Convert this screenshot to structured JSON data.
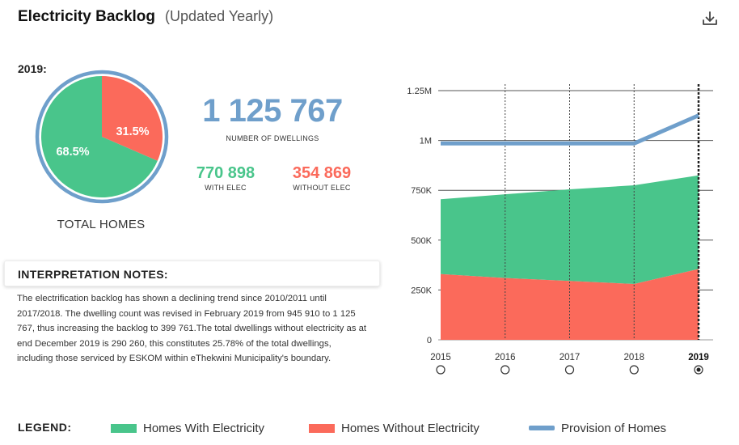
{
  "header": {
    "title": "Electricity Backlog",
    "subtitle": "(Updated Yearly)",
    "download_icon": "download-icon"
  },
  "year_label": "2019:",
  "pie": {
    "slices": [
      {
        "label": "68.5%",
        "value": 68.5,
        "color": "#49c58b"
      },
      {
        "label": "31.5%",
        "value": 31.5,
        "color": "#fb6a5b"
      }
    ],
    "ring_color": "#6f9fcb",
    "caption": "TOTAL HOMES"
  },
  "stats": {
    "dwellings_value": "1 125 767",
    "dwellings_caption": "NUMBER OF DWELLINGS",
    "with_elec_value": "770 898",
    "with_elec_caption": "WITH ELEC",
    "without_elec_value": "354 869",
    "without_elec_caption": "WITHOUT ELEC"
  },
  "notes": {
    "title": "INTERPRETATION NOTES:",
    "text": "The electrification backlog has shown a declining trend since 2010/2011 until 2017/2018. The dwelling count was revised in February 2019 from 945 910 to 1 125 767, thus increasing the backlog to 399 761.The total dwellings without electricity as at end December 2019 is 290 260, this constitutes 25.78% of the total dwellings, including those serviced by ESKOM within eThekwini Municipality's boundary."
  },
  "legend": {
    "title": "LEGEND:",
    "items": [
      {
        "label": "Homes With Electricity",
        "color": "#49c58b",
        "kind": "area"
      },
      {
        "label": "Homes Without Electricity",
        "color": "#fb6a5b",
        "kind": "area"
      },
      {
        "label": "Provision of Homes",
        "color": "#6f9fcb",
        "kind": "line"
      }
    ]
  },
  "chart_data": {
    "type": "area",
    "categories": [
      "2015",
      "2016",
      "2017",
      "2018",
      "2019"
    ],
    "selected_category": "2019",
    "series": [
      {
        "name": "Homes Without Electricity",
        "values": [
          330000,
          310000,
          295000,
          280000,
          354869
        ],
        "color": "#fb6a5b"
      },
      {
        "name": "Homes With Electricity",
        "values": [
          375000,
          420000,
          460000,
          495000,
          470000
        ],
        "color": "#49c58b",
        "stacked": true
      },
      {
        "name": "Provision of Homes",
        "values": [
          985000,
          985000,
          985000,
          985000,
          1125767
        ],
        "color": "#6f9fcb",
        "kind": "line"
      }
    ],
    "y_ticks": [
      {
        "value": 0,
        "label": "0"
      },
      {
        "value": 250000,
        "label": "250K"
      },
      {
        "value": 500000,
        "label": "500K"
      },
      {
        "value": 750000,
        "label": "750K"
      },
      {
        "value": 1000000,
        "label": "1M"
      },
      {
        "value": 1250000,
        "label": "1.25M"
      }
    ],
    "ylim": [
      0,
      1250000
    ],
    "grid": true
  }
}
